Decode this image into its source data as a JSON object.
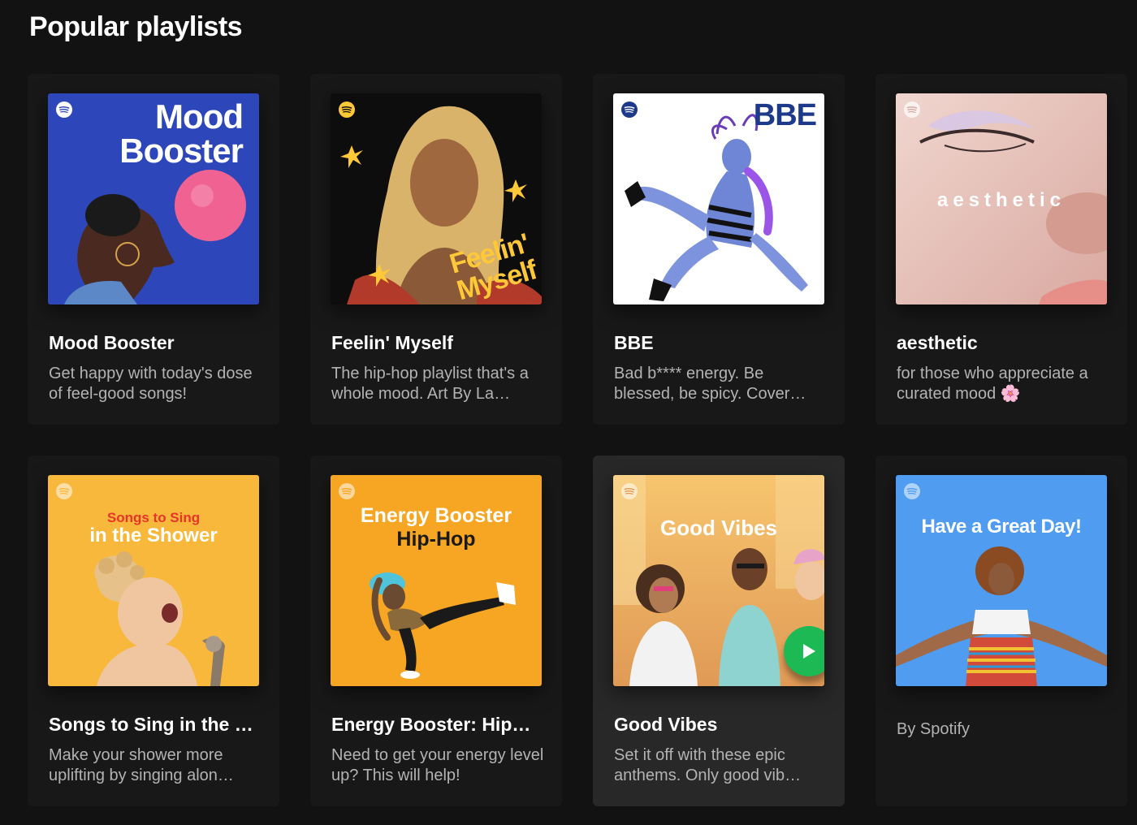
{
  "section": {
    "title": "Popular playlists"
  },
  "playlists": [
    {
      "title": "Mood Booster",
      "description": "Get happy with today's dose of feel-good songs!",
      "cover_text": [
        "Mood",
        "Booster"
      ],
      "cover_color": "#2d46b9"
    },
    {
      "title": "Feelin' Myself",
      "description": "The hip-hop playlist that's a whole mood. Art By La…",
      "cover_text": [
        "Feelin'",
        "Myself"
      ],
      "cover_color": "#0d0d0d"
    },
    {
      "title": "BBE",
      "description": "Bad b**** energy. Be blessed, be spicy. Cover…",
      "cover_text": [
        "BBE"
      ],
      "cover_color": "#ffffff"
    },
    {
      "title": "aesthetic",
      "description": "for those who appreciate a curated mood 🌸",
      "cover_text": [
        "aesthetic"
      ],
      "cover_color": "#e8c9c2"
    },
    {
      "title": "Songs to Sing in the …",
      "description": "Make your shower more uplifting by singing alon…",
      "cover_text": [
        "Songs to Sing",
        "in the Shower"
      ],
      "cover_color": "#f8b83c"
    },
    {
      "title": "Energy Booster: Hip…",
      "description": "Need to get your energy level up? This will help!",
      "cover_text": [
        "Energy Booster",
        "Hip-Hop"
      ],
      "cover_color": "#f6a623"
    },
    {
      "title": "Good Vibes",
      "description": "Set it off with these epic anthems. Only good vib…",
      "cover_text": [
        "Good Vibes"
      ],
      "cover_color": "#f2b45a"
    },
    {
      "title": "",
      "description": "By Spotify",
      "cover_text": [
        "Have a Great Day!"
      ],
      "cover_color": "#4f9cf0"
    }
  ],
  "icons": {
    "spotify": "spotify-logo-icon",
    "play": "play-icon"
  },
  "colors": {
    "background": "#121212",
    "card": "#181818",
    "card_hover": "#282828",
    "accent_green": "#1db954",
    "subtext": "#b3b3b3"
  }
}
